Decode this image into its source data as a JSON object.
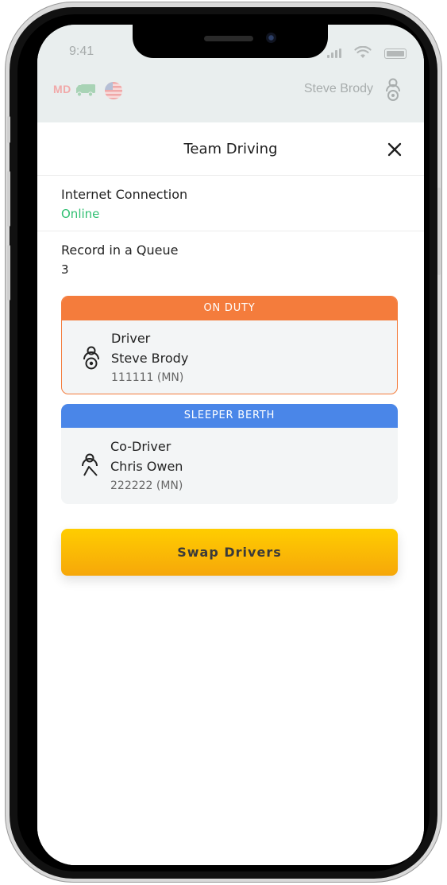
{
  "status_bar": {
    "time": "9:41",
    "icons": [
      "signal-icon",
      "wifi-icon",
      "battery-icon"
    ]
  },
  "header": {
    "state_badge": "MD",
    "icons": [
      "truck-icon",
      "us-flag-icon",
      "driver-icon"
    ],
    "user_name": "Steve Brody"
  },
  "sheet": {
    "title": "Team Driving",
    "close_icon": "close-icon",
    "internet": {
      "label": "Internet Connection",
      "value": "Online",
      "value_color": "#2fbf71"
    },
    "queue": {
      "label": "Record in a Queue",
      "value": "3"
    }
  },
  "driver_card": {
    "status": "ON DUTY",
    "status_color": "#f47c3c",
    "icon": "driver-wheel-icon",
    "role": "Driver",
    "name": "Steve Brody",
    "id": "111111 (MN)"
  },
  "codriver_card": {
    "status": "SLEEPER BERTH",
    "status_color": "#4a86e8",
    "icon": "codriver-seat-icon",
    "role": "Co-Driver",
    "name": "Chris Owen",
    "id": "222222 (MN)"
  },
  "actions": {
    "swap_label": "Swap Drivers",
    "swap_color": "#fdbf06"
  }
}
